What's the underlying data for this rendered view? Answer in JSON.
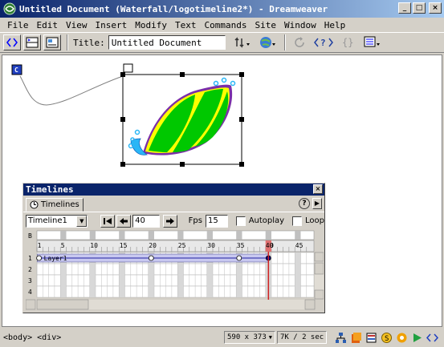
{
  "window": {
    "title": "Untitled Document (Waterfall/logotimeline2*) - Dreamweaver",
    "controls": {
      "minimize": "_",
      "maximize": "□",
      "close": "×"
    }
  },
  "menu": [
    "File",
    "Edit",
    "View",
    "Insert",
    "Modify",
    "Text",
    "Commands",
    "Site",
    "Window",
    "Help"
  ],
  "toolbar": {
    "title_label": "Title:",
    "title_value": "Untitled Document",
    "icons": [
      "code-view-icon",
      "split-view-icon",
      "design-view-icon",
      "file-management-icon",
      "preview-browser-icon",
      "refresh-icon",
      "reference-icon",
      "code-navigation-icon",
      "view-options-icon"
    ]
  },
  "timelines": {
    "title": "Timelines",
    "tab": "Timelines",
    "help": "?",
    "menu": "▶",
    "selected_timeline": "Timeline1",
    "frame": "40",
    "fps_label": "Fps",
    "fps": "15",
    "autoplay_label": "Autoplay",
    "loop_label": "Loop",
    "behavior_row_label": "B",
    "frame_numbers": [
      "1",
      "5",
      "10",
      "15",
      "20",
      "25",
      "30",
      "35",
      "40",
      "45"
    ],
    "channels": [
      "1",
      "2",
      "3",
      "4"
    ],
    "layer": "Layer1",
    "keyframes": [
      1,
      20,
      35,
      40
    ],
    "playhead_frame": 40
  },
  "status": {
    "tags": "<body> <div>",
    "window_size": "590 x 373",
    "download": "7K / 2 sec"
  }
}
